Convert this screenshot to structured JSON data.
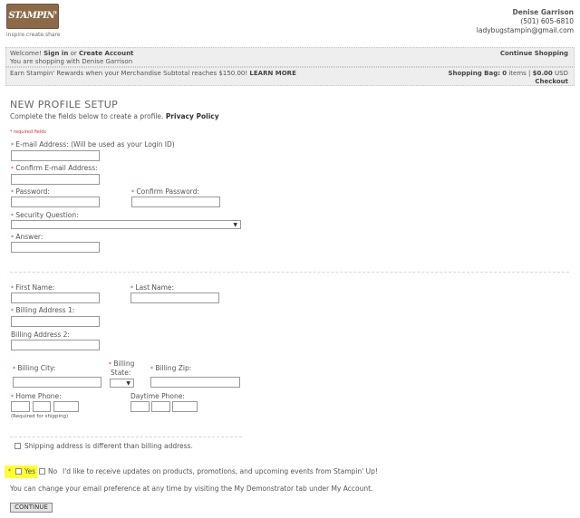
{
  "header": {
    "logo_text": "STAMPIN' UP!",
    "tagline": "inspire.create.share",
    "contact_name": "Denise Garrison",
    "contact_phone": "(501) 605-6810",
    "contact_email": "ladybugstampin@gmail.com"
  },
  "welcome_bar": {
    "welcome": "Welcome!",
    "sign_in": "Sign in",
    "or": "or",
    "create_account": "Create Account",
    "shopping_with": "You are shopping with Denise Garrison",
    "continue_shopping": "Continue Shopping"
  },
  "rewards_bar": {
    "message": "Earn Stampin' Rewards when your Merchandise Subtotal reaches $150.00!",
    "learn_more": "LEARN MORE",
    "bag_label": "Shopping Bag:",
    "bag_count": "0",
    "items_label": "items |",
    "amount": "$0.00",
    "currency": "USD",
    "checkout": "Checkout"
  },
  "form": {
    "title": "NEW PROFILE SETUP",
    "intro": "Complete the fields below to create a profile.",
    "privacy_policy": "Privacy Policy",
    "required_note": "* required fields",
    "email_label": "E-mail Address: (Will be used as your Login ID)",
    "confirm_email_label": "Confirm E-mail Address:",
    "password_label": "Password:",
    "confirm_password_label": "Confirm Password:",
    "security_question_label": "Security Question:",
    "answer_label": "Answer:",
    "first_name_label": "First Name:",
    "last_name_label": "Last Name:",
    "billing_address1_label": "Billing Address 1:",
    "billing_address2_label": "Billing Address 2:",
    "billing_city_label": "Billing City:",
    "billing_state_label_1": "Billing",
    "billing_state_label_2": "State:",
    "billing_zip_label": "Billing Zip:",
    "home_phone_label": "Home Phone:",
    "daytime_phone_label": "Daytime Phone:",
    "required_for_shipping": "(Required for shipping)",
    "shipping_different_label": "Shipping address is different than billing address.",
    "yes_label": "Yes",
    "no_label": "No",
    "updates_text": "I'd like to receive updates on products, promotions, and upcoming events from Stampin' Up!",
    "email_pref_text": "You can change your email preference at any time by visiting the My Demonstrator tab under My Account.",
    "continue_button": "CONTINUE"
  },
  "colors": {
    "brand": "#8b6a49",
    "highlight": "#ffff33",
    "required_star": "#cc3333"
  },
  "icons": {
    "select_arrow": "chevron-down-icon"
  }
}
